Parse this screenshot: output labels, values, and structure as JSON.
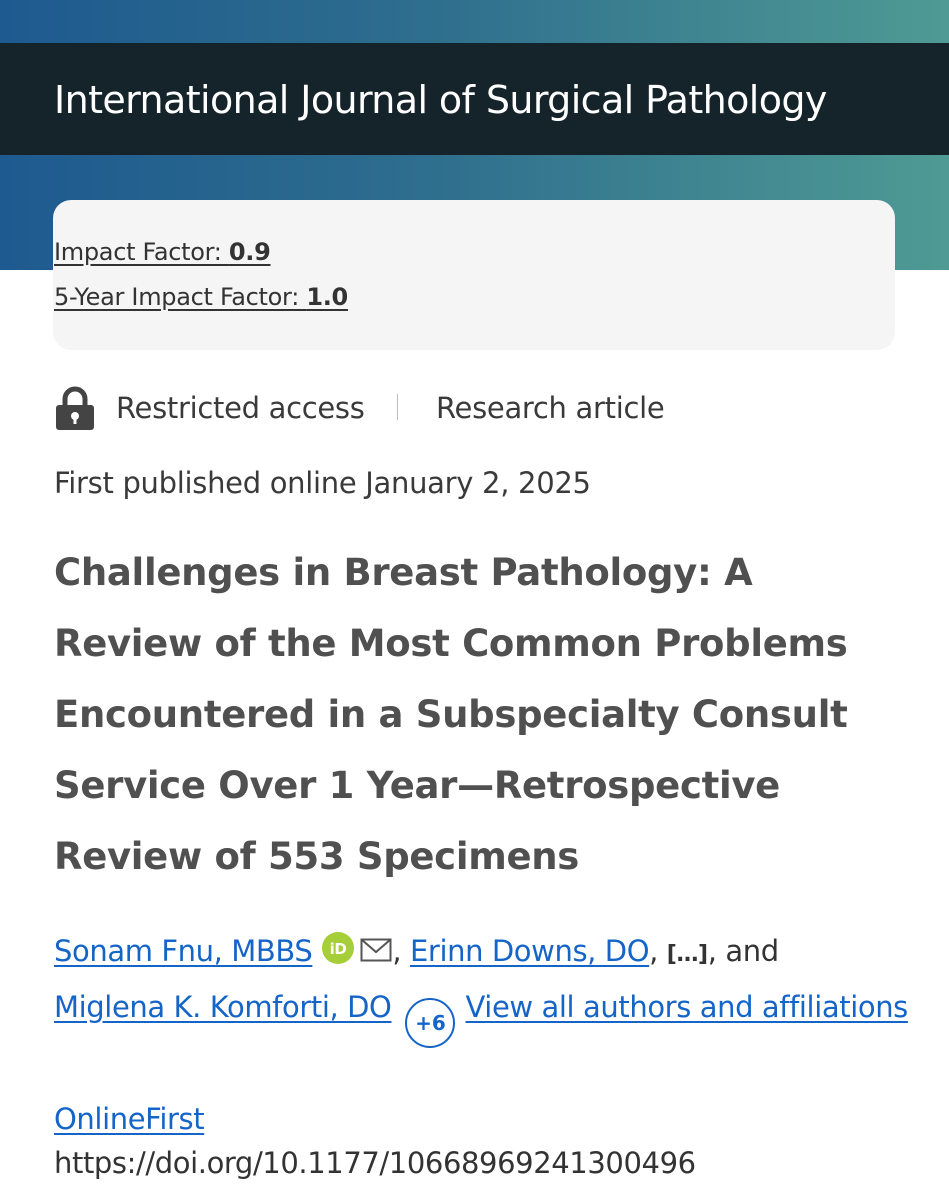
{
  "header": {
    "journal_title": "International Journal of Surgical Pathology"
  },
  "metrics": {
    "impact_factor_label": "Impact Factor: ",
    "impact_factor_value": "0.9",
    "five_year_label": "5-Year Impact Factor: ",
    "five_year_value": "1.0"
  },
  "article_meta": {
    "access": "Restricted access",
    "separator": "|",
    "type": "Research article",
    "published": "First published online January 2, 2025"
  },
  "article": {
    "title": "Challenges in Breast Pathology: A Review of the Most Common Problems Encountered in a Subspecialty Consult Service Over 1 Year—Retrospective Review of 553 Specimens"
  },
  "authors": {
    "author1": "Sonam Fnu, MBBS",
    "comma1": ", ",
    "author2": "Erinn Downs, DO",
    "comma2": ", ",
    "ellipsis": "[…]",
    "and_text": ", and",
    "author3": "Miglena K. Komforti, DO",
    "more_count": "+6",
    "view_all": "View all authors and affiliations"
  },
  "publication": {
    "online_first": "OnlineFirst",
    "doi": "https://doi.org/10.1177/10668969241300496"
  },
  "icons": {
    "lock": "lock-icon",
    "orcid": "orcid-icon",
    "mail": "mail-icon"
  },
  "colors": {
    "title_bar": "#15232b",
    "link": "#1565c8",
    "orcid": "#a6ce39",
    "card_background": "#f5f5f5"
  }
}
